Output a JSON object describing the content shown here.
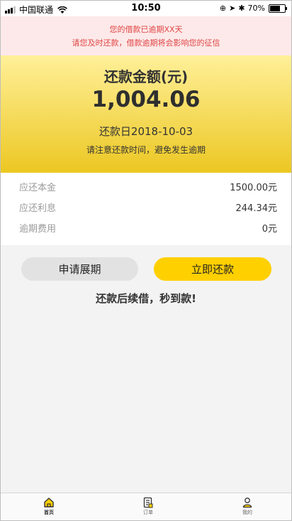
{
  "status_bar": {
    "carrier": "中国联通",
    "time": "10:50",
    "battery": "70%",
    "battery_level": 0.7
  },
  "notice": {
    "line1": "您的借款已逾期XX天",
    "line2": "请您及时还款，借款逾期将会影响您的征信"
  },
  "summary": {
    "title": "还款金额(元)",
    "amount": "1,004.06",
    "due_date": "还款日2018-10-03",
    "tip": "请注意还款时间，避免发生逾期"
  },
  "details": [
    {
      "label": "应还本金",
      "value": "1500.00元"
    },
    {
      "label": "应还利息",
      "value": "244.34元"
    },
    {
      "label": "逾期费用",
      "value": "0元"
    }
  ],
  "actions": {
    "extend_label": "申请展期",
    "repay_label": "立即还款",
    "slogan": "还款后续借，秒到款!"
  },
  "tabs": [
    {
      "label": "首页",
      "icon": "home-icon",
      "active": true
    },
    {
      "label": "订单",
      "icon": "order-icon",
      "active": false
    },
    {
      "label": "我的",
      "icon": "user-icon",
      "active": false
    }
  ],
  "colors": {
    "accent": "#ffd000",
    "notice_text": "#e04545",
    "notice_bg": "#fde9e9"
  }
}
